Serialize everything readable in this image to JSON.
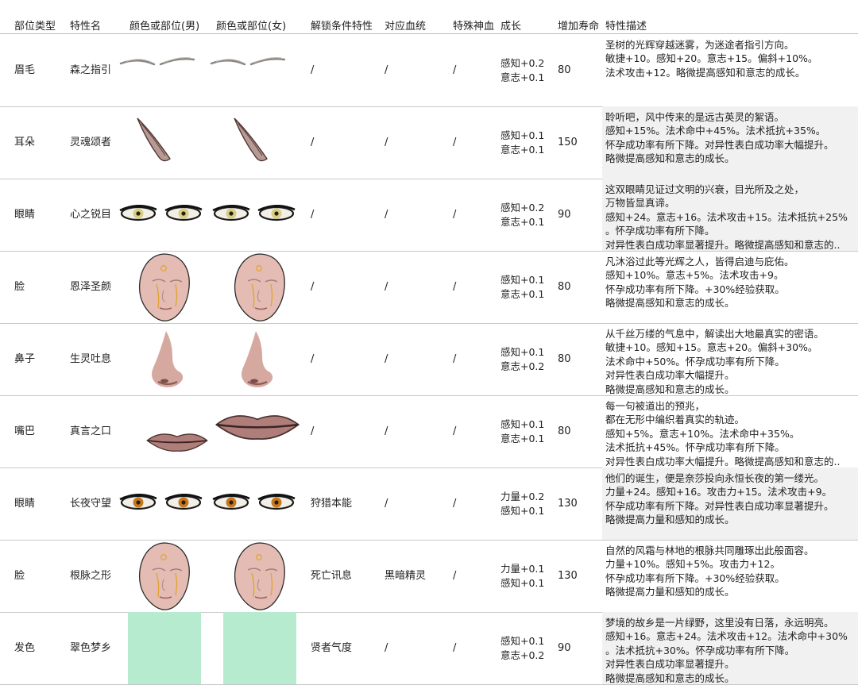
{
  "headers": {
    "part_type": "部位类型",
    "trait_name": "特性名",
    "color_male": "颜色或部位(男)",
    "color_female": "颜色或部位(女)",
    "unlock": "解锁条件特性",
    "bloodline": "对应血统",
    "divine_blood": "特殊神血",
    "growth": "成长",
    "lifespan": "增加寿命",
    "description": "特性描述"
  },
  "rows": [
    {
      "part": "眉毛",
      "name": "森之指引",
      "male_art": "eyebrow-image",
      "female_art": "eyebrow-image",
      "unlock": "/",
      "bloodline": "/",
      "divine": "/",
      "growth": [
        "感知+0.2",
        "意志+0.1"
      ],
      "lifespan": "80",
      "desc": [
        "圣树的光辉穿越迷雾，为迷途者指引方向。",
        "敏捷+10。感知+20。意志+15。偏斜+10%。",
        "法术攻击+12。略微提高感知和意志的成长。"
      ]
    },
    {
      "part": "耳朵",
      "name": "灵魂颂者",
      "male_art": "pointed-ear-image",
      "female_art": "pointed-ear-image",
      "unlock": "/",
      "bloodline": "/",
      "divine": "/",
      "growth": [
        "感知+0.1",
        "意志+0.1"
      ],
      "lifespan": "150",
      "desc": [
        "聆听吧，风中传来的是远古英灵的絮语。",
        "感知+15%。法术命中+45%。法术抵抗+35%。",
        "怀孕成功率有所下降。对异性表白成功率大幅提升。",
        "略微提高感知和意志的成长。"
      ]
    },
    {
      "part": "眼睛",
      "name": "心之锐目",
      "male_art": "eyes-image",
      "female_art": "eyes-image",
      "unlock": "/",
      "bloodline": "/",
      "divine": "/",
      "growth": [
        "感知+0.2",
        "意志+0.1"
      ],
      "lifespan": "90",
      "desc": [
        "这双眼睛见证过文明的兴衰，目光所及之处，",
        "万物皆显真谛。",
        "感知+24。意志+16。法术攻击+15。法术抵抗+25%",
        "。怀孕成功率有所下降。",
        "对异性表白成功率显著提升。略微提高感知和意志的.."
      ]
    },
    {
      "part": "脸",
      "name": "恩泽圣颜",
      "male_art": "face-image",
      "female_art": "face-image",
      "unlock": "/",
      "bloodline": "/",
      "divine": "/",
      "growth": [
        "感知+0.1",
        "意志+0.1"
      ],
      "lifespan": "80",
      "desc": [
        "凡沐浴过此等光辉之人，皆得启迪与庇佑。",
        "感知+10%。意志+5%。法术攻击+9。",
        "怀孕成功率有所下降。+30%经验获取。",
        "略微提高感知和意志的成长。"
      ]
    },
    {
      "part": "鼻子",
      "name": "生灵吐息",
      "male_art": "nose-image",
      "female_art": "nose-image",
      "unlock": "/",
      "bloodline": "/",
      "divine": "/",
      "growth": [
        "感知+0.1",
        "意志+0.2"
      ],
      "lifespan": "80",
      "desc": [
        "从千丝万缕的气息中，解读出大地最真实的密语。",
        "敏捷+10。感知+15。意志+20。偏斜+30%。",
        "法术命中+50%。怀孕成功率有所下降。",
        "对异性表白成功率大幅提升。",
        "略微提高感知和意志的成长。"
      ]
    },
    {
      "part": "嘴巴",
      "name": "真言之口",
      "male_art": "lips-image",
      "female_art": "lips-image",
      "unlock": "/",
      "bloodline": "/",
      "divine": "/",
      "growth": [
        "感知+0.1",
        "意志+0.1"
      ],
      "lifespan": "80",
      "desc": [
        "每一句被道出的预兆，",
        "都在无形中编织着真实的轨迹。",
        "感知+5%。意志+10%。法术命中+35%。",
        "法术抵抗+45%。怀孕成功率有所下降。",
        "对异性表白成功率大幅提升。略微提高感知和意志的.."
      ]
    },
    {
      "part": "眼睛",
      "name": "长夜守望",
      "male_art": "eyes-image",
      "female_art": "eyes-image",
      "unlock": "狩猎本能",
      "bloodline": "/",
      "divine": "/",
      "growth": [
        "力量+0.2",
        "感知+0.1"
      ],
      "lifespan": "130",
      "desc": [
        "他们的诞生，便是奈莎投向永恒长夜的第一缕光。",
        "力量+24。感知+16。攻击力+15。法术攻击+9。",
        "怀孕成功率有所下降。对异性表白成功率显著提升。",
        "略微提高力量和感知的成长。"
      ]
    },
    {
      "part": "脸",
      "name": "根脉之形",
      "male_art": "face-image",
      "female_art": "face-image",
      "unlock": "死亡讯息",
      "bloodline": "黑暗精灵",
      "divine": "/",
      "growth": [
        "力量+0.1",
        "感知+0.1"
      ],
      "lifespan": "130",
      "desc": [
        "自然的风霜与林地的根脉共同雕琢出此般面容。",
        "力量+10%。感知+5%。攻击力+12。",
        "怀孕成功率有所下降。+30%经验获取。",
        "略微提高力量和感知的成长。"
      ]
    },
    {
      "part": "发色",
      "name": "翠色梦乡",
      "male_art": "hair-color-swatch",
      "female_art": "hair-color-swatch",
      "unlock": "贤者气度",
      "bloodline": "/",
      "divine": "/",
      "growth": [
        "感知+0.1",
        "意志+0.2"
      ],
      "lifespan": "90",
      "desc": [
        "梦境的故乡是一片绿野，这里没有日落，永远明亮。",
        "感知+16。意志+24。法术攻击+12。法术命中+30%",
        "。法术抵抗+30%。怀孕成功率有所下降。",
        "对异性表白成功率显著提升。",
        "略微提高感知和意志的成长。"
      ]
    }
  ],
  "colors": {
    "hair_swatch": "#b6ebd0",
    "desc_shade": "#f1f1f1",
    "border": "#c8c8c8"
  }
}
